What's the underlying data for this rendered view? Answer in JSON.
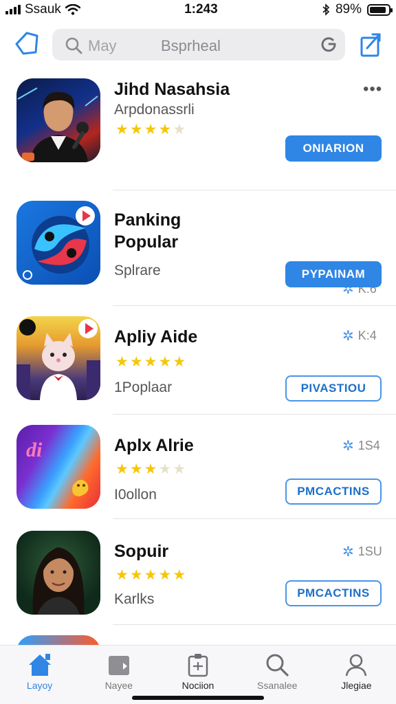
{
  "status": {
    "carrier": "Ssauk",
    "time": "1:243",
    "battery": "89%",
    "battery_level": 0.89
  },
  "search": {
    "placeholder": "May",
    "query": "Bsprheal"
  },
  "apps": [
    {
      "name": "Jihd Nasahsia",
      "subtitle": "Arpdonassrli",
      "stars": 3.5,
      "button": "ONIARION",
      "button_style": "filled",
      "has_more": true,
      "more_label": "•••",
      "icon": "person-mic-icon"
    },
    {
      "name": "Panking",
      "name2": "Popular",
      "subtitle": "Splrare",
      "count": "K:6",
      "button": "PYPAINAM",
      "button_style": "filled",
      "icon": "swirl-icon"
    },
    {
      "name": "Apliy Aide",
      "subtitle": "1Poplaar",
      "stars": 4.5,
      "count": "K:4",
      "button": "PIVASTIOU",
      "button_style": "outline",
      "icon": "cat-character-icon"
    },
    {
      "name": "Aplx Alrie",
      "subtitle": "I0ollon",
      "stars": 3,
      "count": "1S4",
      "button": "PMCACTINS",
      "button_style": "outline",
      "icon": "gradient-logo-icon"
    },
    {
      "name": "Sopuir",
      "subtitle": "Karlks",
      "stars": 4.5,
      "count": "1SU",
      "button": "PMCACTINS",
      "button_style": "outline",
      "icon": "portrait-icon"
    }
  ],
  "tabs": [
    {
      "label": "Layoy",
      "icon": "home-icon",
      "active": true
    },
    {
      "label": "Nayee",
      "icon": "folder-icon",
      "active": false
    },
    {
      "label": "Nociion",
      "icon": "clipboard-icon",
      "active": false
    },
    {
      "label": "Ssanalee",
      "icon": "search-icon",
      "active": false
    },
    {
      "label": "Jlegiae",
      "icon": "profile-icon",
      "active": false
    }
  ],
  "colors": {
    "accent": "#2f86e5",
    "star": "#f5c70a"
  }
}
